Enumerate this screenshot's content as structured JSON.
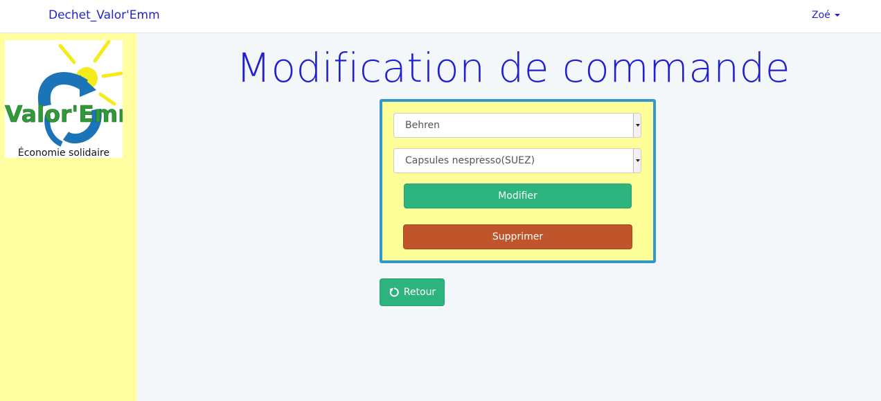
{
  "navbar": {
    "brand": "Dechet_Valor'Emm",
    "user": "Zoé"
  },
  "sidebar": {
    "logo": {
      "name": "Valor'Emm",
      "tagline": "Économie solidaire"
    }
  },
  "main": {
    "title": "Modification de commande",
    "form": {
      "site_select": {
        "value": "Behren"
      },
      "waste_select": {
        "value": "Capsules nespresso(SUEZ)"
      },
      "modify_label": "Modifier",
      "delete_label": "Supprimer"
    },
    "back_label": "Retour"
  },
  "colors": {
    "sidebar_bg": "#ffffa2",
    "title": "#1f1fd3",
    "form_border": "#3399cc",
    "form_bg": "#ffff99",
    "success": "#2db37d",
    "danger": "#c0542a"
  },
  "icons": {
    "user_menu": "caret-down-icon",
    "back": "rotate-ccw-icon"
  }
}
